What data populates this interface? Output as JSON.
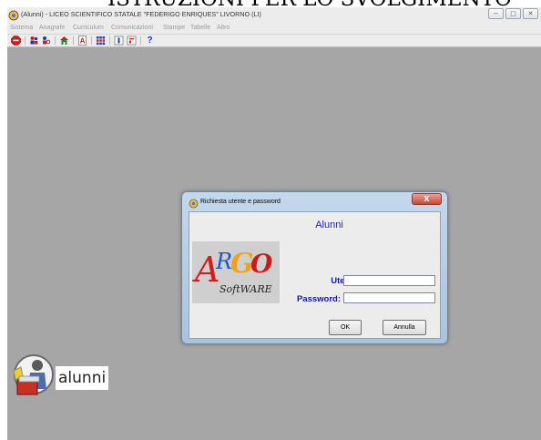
{
  "document_heading": "ISTRUZIONI PER LO SVOLGIMENTO",
  "window": {
    "title": "(Alunni) - LICEO SCIENTIFICO STATALE \"FEDERIGO ENRIQUES\" LIVORNO (LI)",
    "app_icon": "argo-app-icon",
    "controls": {
      "minimize": "−",
      "maximize": "□",
      "close": "✕"
    }
  },
  "menubar": {
    "items": [
      {
        "label": "Sistema"
      },
      {
        "label": "Anagrafe"
      },
      {
        "label": "Curriculum"
      },
      {
        "label": "Comunicazioni"
      },
      {
        "label": "Stampe"
      },
      {
        "label": "Tabelle"
      },
      {
        "label": "Altro"
      }
    ]
  },
  "toolbar": {
    "buttons": [
      {
        "icon": "stop-icon"
      },
      {
        "icon": "users-icon"
      },
      {
        "icon": "user-search-icon"
      },
      {
        "icon": "house-icon"
      },
      {
        "icon": "document-a-icon"
      },
      {
        "icon": "grid-icon"
      },
      {
        "icon": "card-icon"
      },
      {
        "icon": "report-icon"
      },
      {
        "icon": "help-icon",
        "label": "?"
      }
    ],
    "colors": {
      "stop": "#d81a1a",
      "accent_blue": "#1e3aa8",
      "accent_red": "#c82020"
    }
  },
  "dialog": {
    "title": "Richiesta utente e password",
    "close_label": "X",
    "app_name": "Alunni",
    "logo": {
      "text_main": "ARGO",
      "text_sub": "SoftWARE"
    },
    "username_label": "Utente:",
    "username_value": "",
    "password_label": "Password:",
    "password_value": "",
    "ok_label": "OK",
    "cancel_label": "Annulla"
  },
  "desktop_shortcut": {
    "label": "alunni",
    "icon": "alunni-shortcut-icon"
  }
}
